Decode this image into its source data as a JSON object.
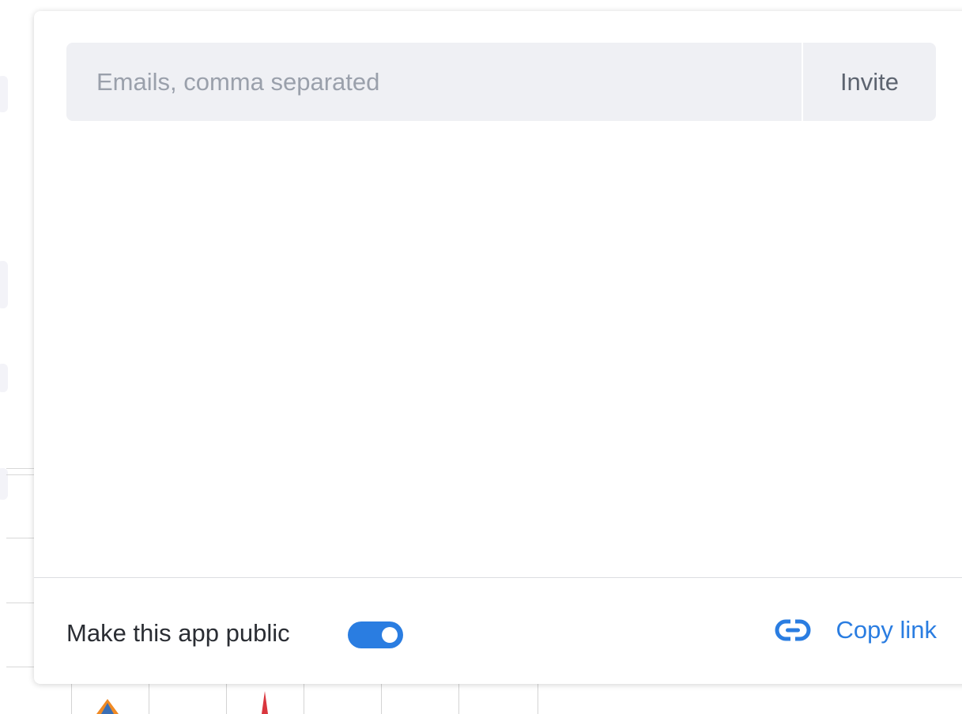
{
  "invite": {
    "placeholder": "Emails, comma separated",
    "value": "",
    "button_label": "Invite"
  },
  "footer": {
    "public_label": "Make this app public",
    "public_enabled": true,
    "copy_link_label": "Copy link"
  },
  "colors": {
    "accent": "#2a7de1",
    "input_bg": "#eff0f4"
  },
  "icons": {
    "toggle": "toggle-switch-icon",
    "link": "link-icon"
  }
}
